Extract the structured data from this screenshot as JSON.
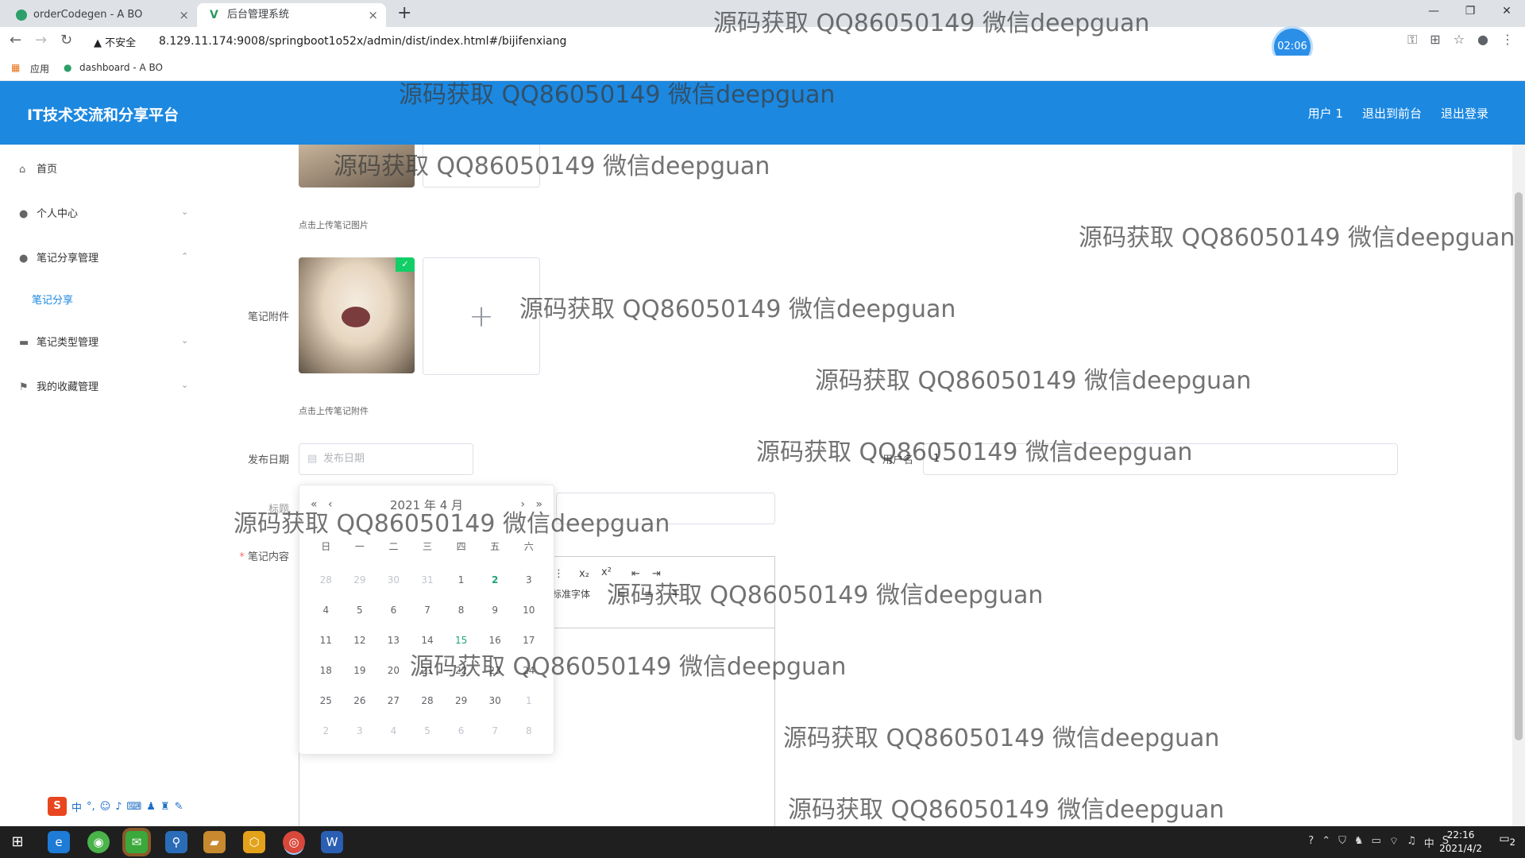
{
  "browser": {
    "tabs": [
      {
        "title": "orderCodegen - A BO",
        "close": "×"
      },
      {
        "title": "后台管理系统",
        "close": "×",
        "favicon": "V"
      }
    ],
    "new_tab": "+",
    "window_controls": [
      "—",
      "❐",
      "✕"
    ],
    "url_warning": "▲ 不安全",
    "url": "8.129.11.174:9008/springboot1o52x/admin/dist/index.html#/bijifenxiang",
    "timer": "02:06",
    "bookmarks": {
      "apps": "应用",
      "dashboard": "dashboard - A BO"
    }
  },
  "header": {
    "title": "IT技术交流和分享平台",
    "user": "用户 1",
    "to_front": "退出到前台",
    "logout": "退出登录"
  },
  "sidebar": {
    "items": [
      {
        "label": "首页",
        "icon": "home-icon"
      },
      {
        "label": "个人中心",
        "icon": "user-icon"
      },
      {
        "label": "笔记分享管理",
        "icon": "user-icon"
      },
      {
        "label": "笔记分享",
        "sub": true
      },
      {
        "label": "笔记类型管理",
        "icon": "monitor-icon"
      },
      {
        "label": "我的收藏管理",
        "icon": "flag-icon"
      }
    ]
  },
  "form": {
    "image_hint": "点击上传笔记图片",
    "attachment_label": "笔记附件",
    "attachment_hint": "点击上传笔记附件",
    "date_label": "发布日期",
    "date_placeholder": "发布日期",
    "user_label": "用户名",
    "user_value": "1",
    "title_label": "标题",
    "content_label": "笔记内容",
    "required_mark": "*",
    "plus": "+",
    "editor_toolbar": {
      "sub": "x₂",
      "sup": "x²",
      "font": "标准字体"
    }
  },
  "datepicker": {
    "prev_year": "«",
    "prev_month": "‹",
    "title": "2021 年 4 月",
    "next_month": "›",
    "next_year": "»",
    "weekdays": [
      "日",
      "一",
      "二",
      "三",
      "四",
      "五",
      "六"
    ],
    "rows": [
      [
        "28",
        "29",
        "30",
        "31",
        "1",
        "2",
        "3"
      ],
      [
        "4",
        "5",
        "6",
        "7",
        "8",
        "9",
        "10"
      ],
      [
        "11",
        "12",
        "13",
        "14",
        "15",
        "16",
        "17"
      ],
      [
        "18",
        "19",
        "20",
        "21",
        "22",
        "23",
        "24"
      ],
      [
        "25",
        "26",
        "27",
        "28",
        "29",
        "30",
        "1"
      ],
      [
        "2",
        "3",
        "4",
        "5",
        "6",
        "7",
        "8"
      ]
    ],
    "today": "2",
    "hovered": "15"
  },
  "watermark": "源码获取 QQ86050149 微信deepguan",
  "ime": {
    "logo": "S",
    "mode": "中",
    "punct": "°,"
  },
  "taskbar": {
    "time": "22:16",
    "date": "2021/4/2",
    "ime_indicator": "中",
    "notifications": "2"
  },
  "colors": {
    "header": "#1c88e0",
    "today": "#1fa37a",
    "sidebar_active": "#1c88e0"
  }
}
